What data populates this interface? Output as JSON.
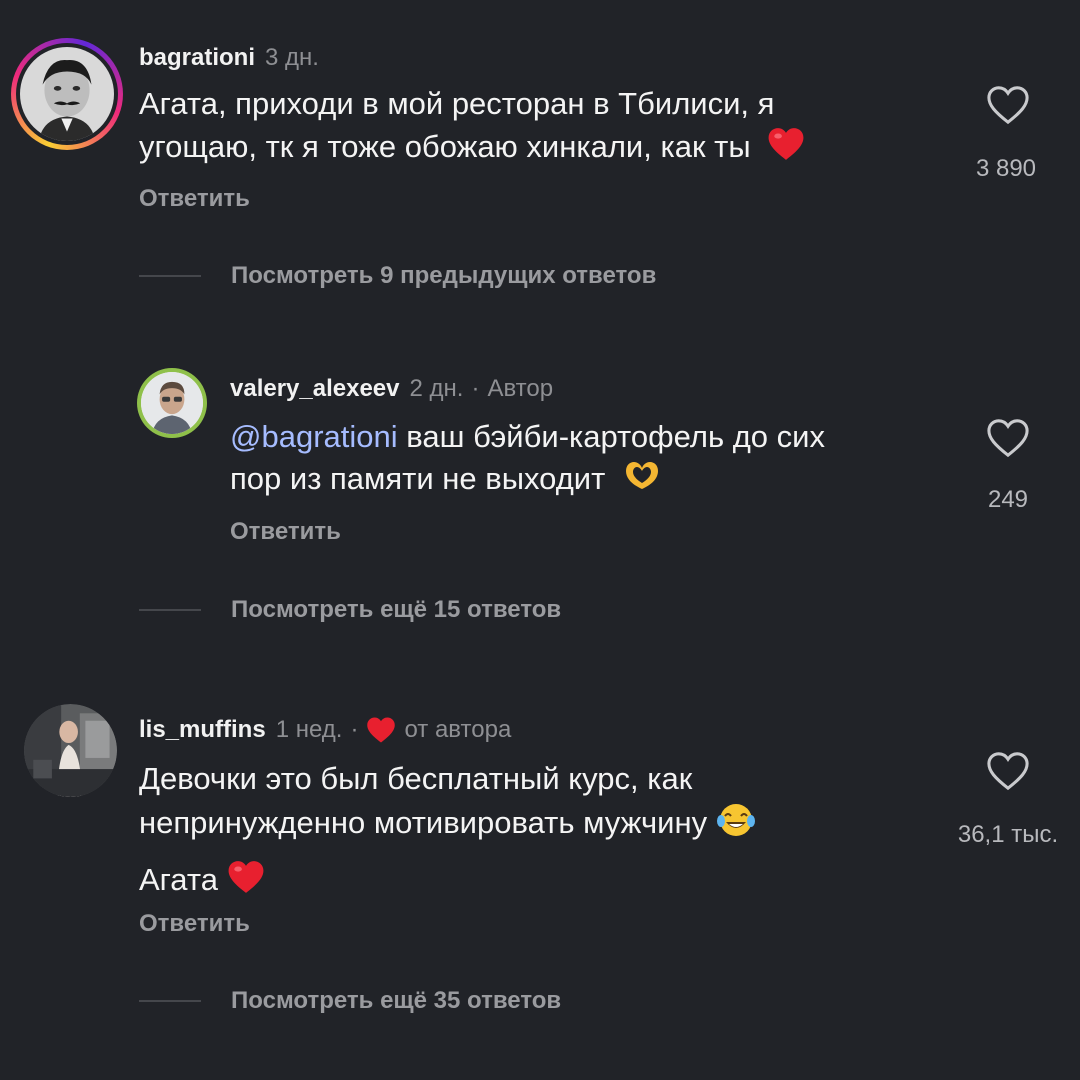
{
  "comments": [
    {
      "username": "bagrationi",
      "time": "3 дн.",
      "text_line1": "Агата, приходи в мой ресторан в Тбилиси, я",
      "text_line2": "угощаю, тк я тоже обожаю хинкали, как ты",
      "reply_label": "Ответить",
      "likes": "3 890",
      "thread_label": "Посмотреть 9 предыдущих ответов"
    },
    {
      "username": "valery_alexeev",
      "time": "2 дн.",
      "separator": "·",
      "author_tag": "Автор",
      "mention": "@bagrationi",
      "text_line1_rest": " ваш бэйби-картофель до сих",
      "text_line2": "пор из памяти не выходит",
      "reply_label": "Ответить",
      "likes": "249",
      "thread_label": "Посмотреть ещё 15 ответов"
    },
    {
      "username": "lis_muffins",
      "time": "1 нед.",
      "separator": "·",
      "liked_by": "от автора",
      "text_line1": "Девочки это был бесплатный курс, как",
      "text_line2": "непринужденно мотивировать мужчину",
      "text_line3": "Агата",
      "reply_label": "Ответить",
      "likes": "36,1 тыс.",
      "thread_label": "Посмотреть ещё 35 ответов"
    }
  ],
  "icons": {
    "like": "heart-outline-icon",
    "heart_emoji": "red-heart-emoji",
    "hands_emoji": "heart-hands-emoji",
    "laugh_emoji": "tears-of-joy-emoji"
  },
  "colors": {
    "background": "#212328",
    "mention": "#a6bcff",
    "heart": "#e8202f"
  }
}
